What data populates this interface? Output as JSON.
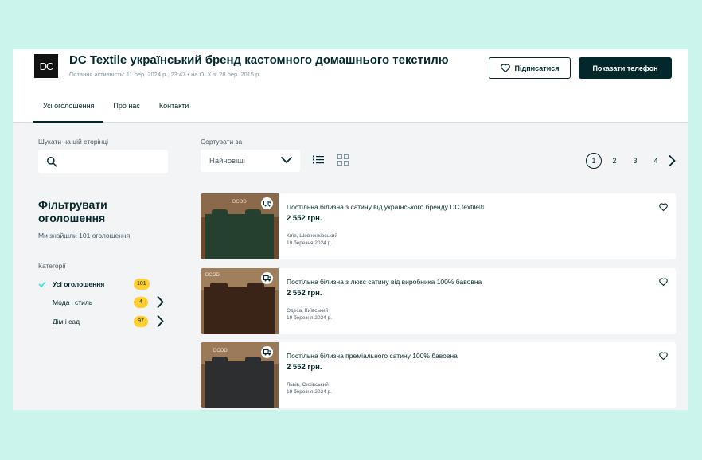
{
  "shop": {
    "logo_text": "DC",
    "title": "DC Textile український бренд кастомного домашнього текстилю",
    "meta": "Остання активність: 11 бер. 2024 р., 23:47  •  на OLX з: 28 бер. 2015 р.",
    "follow_label": "Підписатися",
    "phone_label": "Показати телефон"
  },
  "tabs": [
    "Усі оголошення",
    "Про нас",
    "Контакти"
  ],
  "search": {
    "label": "Шукати на цій сторінці",
    "placeholder": ""
  },
  "sort": {
    "label": "Сортувати за",
    "value": "Найновіші"
  },
  "pagination": {
    "pages": [
      "1",
      "2",
      "3",
      "4"
    ],
    "current": "1"
  },
  "filters": {
    "title": "Фільтрувати оголошення",
    "found": "Ми знайшли 101 оголошення",
    "categories_label": "Категорії",
    "categories": [
      {
        "name": "Усі оголошення",
        "count": "101",
        "selected": true
      },
      {
        "name": "Мода і стиль",
        "count": "4",
        "selected": false
      },
      {
        "name": "Дім і сад",
        "count": "97",
        "selected": false
      }
    ]
  },
  "listings": [
    {
      "title": "Постільна білизна з сатину від українського бренду DC textile®",
      "price": "2 552 грн.",
      "location": "Київ, Шевченківський",
      "date": "19 березня 2024 р.",
      "image_color": "#25402f",
      "image_label": "DCOD"
    },
    {
      "title": "Постільна білизна з люкс сатину від виробника 100% бавовна",
      "price": "2 552 грн.",
      "location": "Одеса, Київський",
      "date": "19 березня 2024 р.",
      "image_color": "#3a2418",
      "image_label": "DCOD"
    },
    {
      "title": "Постільна білизна преміального сатину 100% бавовна",
      "price": "2 552 грн.",
      "location": "Львів, Сихівський",
      "date": "19 березня 2024 р.",
      "image_color": "#2c2e30",
      "image_label": "DCOD"
    }
  ],
  "colors": {
    "primary": "#02282c",
    "badge": "#ffce32",
    "check": "#23e5db",
    "page_bg": "#cbf4ec"
  }
}
